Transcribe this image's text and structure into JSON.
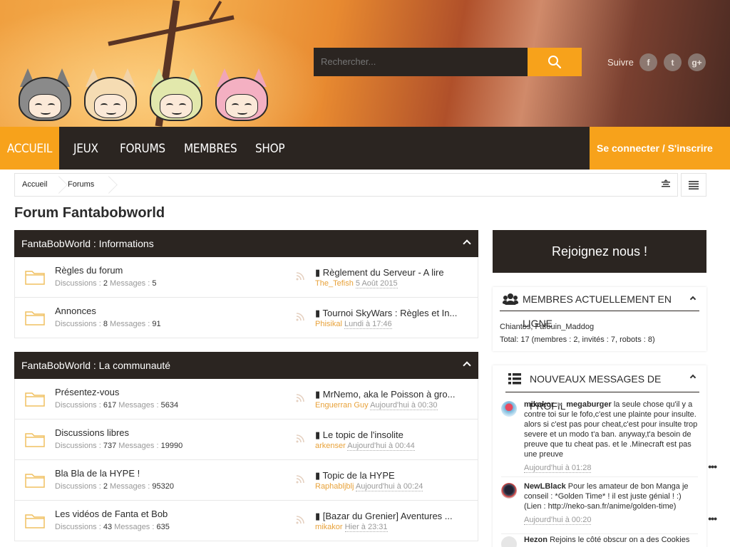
{
  "header": {
    "search_placeholder": "Rechercher...",
    "follow_label": "Suivre",
    "social": [
      "f",
      "t",
      "g+"
    ]
  },
  "nav": {
    "items": [
      "Accueil",
      "Jeux",
      "Forums",
      "Membres",
      "Shop"
    ],
    "login": "Se connecter / S'inscrire"
  },
  "breadcrumb": [
    "Accueil",
    "Forums"
  ],
  "page_title": "Forum Fantabobworld",
  "categories": [
    {
      "title": "FantaBobWorld : Informations",
      "nodes": [
        {
          "title": "Règles du forum",
          "discussions_label": "Discussions :",
          "discussions": "2",
          "messages_label": "Messages :",
          "messages": "5",
          "last_title": "Règlement du Serveur - A lire",
          "last_user": "The_Tefish",
          "last_date": "5 Août 2015"
        },
        {
          "title": "Annonces",
          "discussions_label": "Discussions :",
          "discussions": "8",
          "messages_label": "Messages :",
          "messages": "91",
          "last_title": "Tournoi SkyWars : Règles et In...",
          "last_user": "Phisikal",
          "last_date": "Lundi à 17:46"
        }
      ]
    },
    {
      "title": "FantaBobWorld : La communauté",
      "nodes": [
        {
          "title": "Présentez-vous",
          "discussions_label": "Discussions :",
          "discussions": "617",
          "messages_label": "Messages :",
          "messages": "5634",
          "last_title": "MrNemo, aka le Poisson à gro...",
          "last_user": "Enguerran Guy",
          "last_date": "Aujourd'hui à 00:30"
        },
        {
          "title": "Discussions libres",
          "discussions_label": "Discussions :",
          "discussions": "737",
          "messages_label": "Messages :",
          "messages": "19990",
          "last_title": "Le topic de l'insolite",
          "last_user": "arkenser",
          "last_date": "Aujourd'hui à 00:44"
        },
        {
          "title": "Bla Bla de la HYPE !",
          "discussions_label": "Discussions :",
          "discussions": "2",
          "messages_label": "Messages :",
          "messages": "95320",
          "last_title": "Topic de la HYPE",
          "last_user": "Raphabljblj",
          "last_date": "Aujourd'hui à 00:24"
        },
        {
          "title": "Les vidéos de Fanta et Bob",
          "discussions_label": "Discussions :",
          "discussions": "43",
          "messages_label": "Messages :",
          "messages": "635",
          "last_title": "[Bazar du Grenier] Aventures ...",
          "last_user": "mikakor",
          "last_date": "Hier à 23:31"
        }
      ]
    }
  ],
  "sidebar": {
    "join": "Rejoignez nous !",
    "online": {
      "title": "Membres actuellement en ligne",
      "members": "Chiantos, Fafouin_Maddog",
      "total": "Total: 17 (membres : 2, invités : 7, robots : 8)"
    },
    "profile_posts": {
      "title": "Nouveaux messages de profil",
      "posts": [
        {
          "author": "mikakor",
          "arrow": "►",
          "target": "megaburger",
          "text": "la seule chose qu'il y a contre toi sur le fofo,c'est une plainte pour insulte. alors si c'est pas pour cheat,c'est pour insulte trop severe et un modo t'a ban. anyway,t'a besoin de preuve que tu cheat pas. et le .Minecraft est pas une preuve",
          "date": "Aujourd'hui à 01:28",
          "more": "•••"
        },
        {
          "author": "NewLBlack",
          "arrow": "",
          "target": "",
          "text": "Pour les amateur de bon Manga je conseil : *Golden Time* ! il est juste génial ! :) (Lien : http://neko-san.fr/anime/golden-time)",
          "date": "Aujourd'hui à 00:20",
          "more": "•••"
        },
        {
          "author": "Hezon",
          "arrow": "",
          "target": "",
          "text": "Rejoins le côté obscur on a des Cookies",
          "date": "",
          "more": ""
        }
      ]
    }
  },
  "colors": {
    "accent": "#f7a21b",
    "dark": "#2b2521",
    "user": "#e8a23a"
  }
}
